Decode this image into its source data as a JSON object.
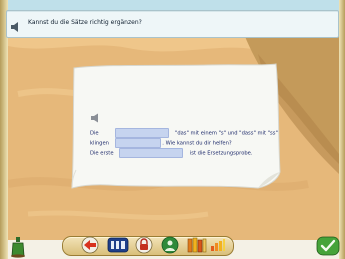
{
  "header": {
    "title": "Kannst du die Sätze richtig ergänzen?"
  },
  "exercise": {
    "line1": {
      "pre": "Die",
      "post": "\"das\" mit einem \"s\" und \"dass\" mit \"ss\""
    },
    "line2": {
      "pre": "klingen",
      "post": ". Wie kannst du dir helfen?"
    },
    "line3": {
      "pre": "Die erste",
      "post": "ist die Ersetzungsprobe."
    }
  },
  "toolbar": {
    "icons": [
      "bottle-icon",
      "arrow-icon",
      "mode-icon",
      "lock-icon",
      "person-icon",
      "books-icon",
      "chart-icon",
      "check-icon"
    ]
  },
  "colors": {
    "sky": "#bfe0ea",
    "sand": "#e6b87a",
    "paper": "#f7f8f4",
    "gap": "#c6d4ef",
    "text": "#1d2a6a"
  }
}
